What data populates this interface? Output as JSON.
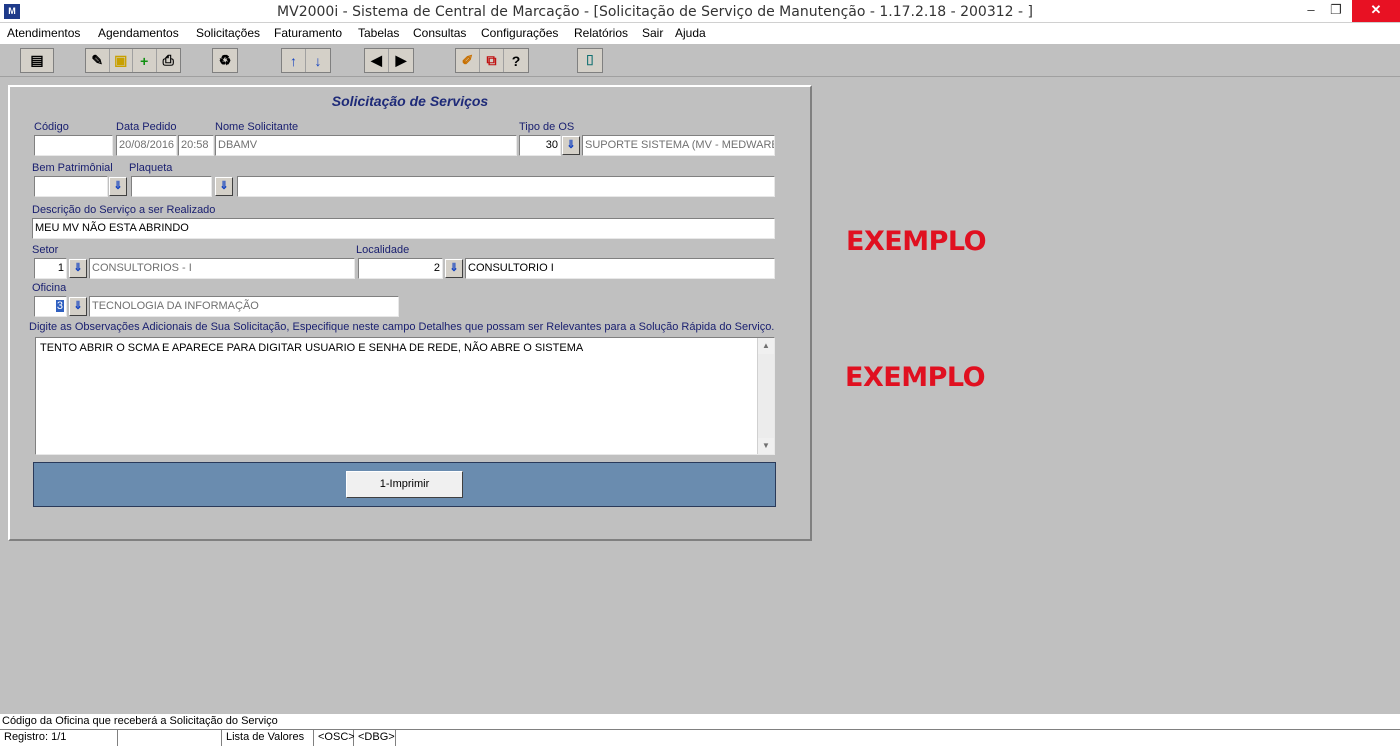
{
  "window": {
    "title": "MV2000i - Sistema de Central de Marcação - [Solicitação de Serviço de Manutenção - 1.17.2.18 - 200312 -                    ]",
    "app_icon": "mv-app-icon",
    "minimize": "‒",
    "maximize": "❐",
    "close": "✕"
  },
  "menu": [
    "Atendimentos",
    "Agendamentos",
    "Solicitações",
    "Faturamento",
    "Tabelas",
    "Consultas",
    "Configurações",
    "Relatórios",
    "Sair",
    "Ajuda"
  ],
  "toolbar": {
    "icons": [
      "open-list-icon",
      "edit-icon",
      "save-icon",
      "add-icon",
      "print-icon",
      "clear-icon",
      "up-arrow-icon",
      "down-arrow-icon",
      "previous-icon",
      "next-icon",
      "pencil-icon",
      "copy-icon",
      "help-icon",
      "exit-door-icon"
    ]
  },
  "form": {
    "title": "Solicitação de Serviços",
    "codigo": {
      "label": "Código",
      "value": ""
    },
    "data_pedido": {
      "label": "Data Pedido",
      "date": "20/08/2016",
      "time": "20:58"
    },
    "nome_solicitante": {
      "label": "Nome Solicitante",
      "value": "DBAMV"
    },
    "tipo_os": {
      "label": "Tipo de OS",
      "code": "30",
      "description": "SUPORTE SISTEMA (MV - MEDWARE -"
    },
    "bem_patrimonial": {
      "label": "Bem Patrimônial",
      "value": ""
    },
    "plaqueta": {
      "label": "Plaqueta",
      "value": "",
      "description": ""
    },
    "descricao": {
      "label": "Descrição do Serviço a ser Realizado",
      "value": "MEU MV NÃO ESTA ABRINDO"
    },
    "setor": {
      "label": "Setor",
      "code": "1",
      "description": "CONSULTORIOS - I"
    },
    "localidade": {
      "label": "Localidade",
      "code": "2",
      "description": "CONSULTORIO I"
    },
    "oficina": {
      "label": "Oficina",
      "code": "3",
      "description": "TECNOLOGIA DA INFORMAÇÃO"
    },
    "observacoes": {
      "label": "Digite as Observações  Adicionais de Sua Solicitação, Especifique neste campo Detalhes que possam ser Relevantes para a Solução Rápida do Serviço.",
      "value": "TENTO ABRIR O SCMA E APARECE PARA DIGITAR USUARIO E SENHA DE REDE, NÃO ABRE O SISTEMA"
    },
    "print_button": "1-Imprimir"
  },
  "watermarks": [
    "EXEMPLO",
    "EXEMPLO"
  ],
  "hint": "Código da Oficina que receberá a Solicitação do Serviço",
  "status": {
    "registro": "Registro: 1/1",
    "blank": "",
    "lista": "Lista de Valores",
    "osc": "<OSC>",
    "dbg": "<DBG>"
  }
}
